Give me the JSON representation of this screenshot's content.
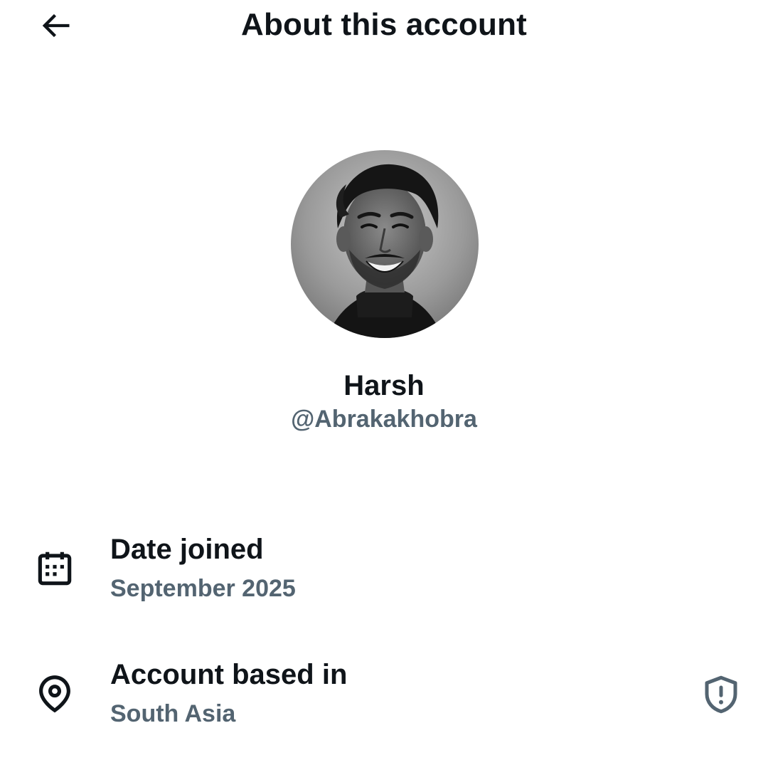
{
  "header": {
    "title": "About this account",
    "back_icon": "arrow-left-icon"
  },
  "profile": {
    "display_name": "Harsh",
    "handle": "@Abrakakhobra",
    "avatar_description_icon": "avatar-photo"
  },
  "details": {
    "date_joined": {
      "label": "Date joined",
      "value": "September 2025",
      "icon": "calendar-icon"
    },
    "account_based_in": {
      "label": "Account based in",
      "value": "South Asia",
      "icon": "location-pin-icon",
      "action_icon": "shield-alert-icon"
    }
  },
  "colors": {
    "primary_text": "#0f1419",
    "secondary_text": "#536471",
    "background": "#ffffff"
  }
}
